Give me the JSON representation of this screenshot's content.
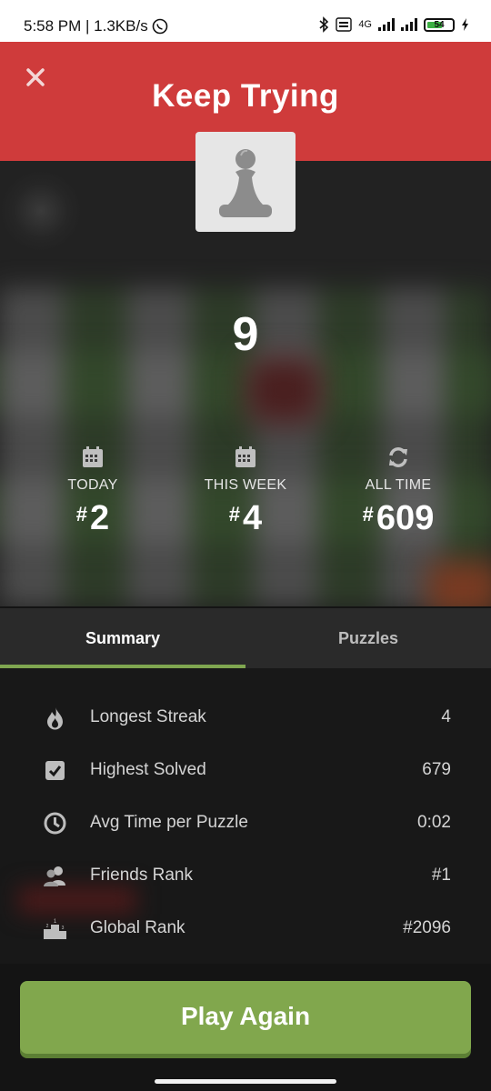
{
  "status_bar": {
    "time_speed": "5:58 PM | 1.3KB/s",
    "network": "4G",
    "battery": "54"
  },
  "header": {
    "title": "Keep Trying"
  },
  "score": "9",
  "ranks": [
    {
      "icon": "calendar-icon",
      "label": "TODAY",
      "hash": "#",
      "value": "2"
    },
    {
      "icon": "calendar-icon",
      "label": "THIS WEEK",
      "hash": "#",
      "value": "4"
    },
    {
      "icon": "refresh-icon",
      "label": "ALL TIME",
      "hash": "#",
      "value": "609"
    }
  ],
  "tabs": [
    {
      "label": "Summary",
      "active": true
    },
    {
      "label": "Puzzles",
      "active": false
    }
  ],
  "summary": [
    {
      "icon": "flame-icon",
      "label": "Longest Streak",
      "value": "4"
    },
    {
      "icon": "checkbox-icon",
      "label": "Highest Solved",
      "value": "679"
    },
    {
      "icon": "clock-icon",
      "label": "Avg Time per Puzzle",
      "value": "0:02"
    },
    {
      "icon": "friends-icon",
      "label": "Friends Rank",
      "value": "#1"
    },
    {
      "icon": "podium-icon",
      "label": "Global Rank",
      "value": "#2096"
    }
  ],
  "play_again": "Play Again",
  "colors": {
    "header": "#cf3b3b",
    "accent_green": "#81a74d",
    "tab_underline": "#7fa650"
  }
}
